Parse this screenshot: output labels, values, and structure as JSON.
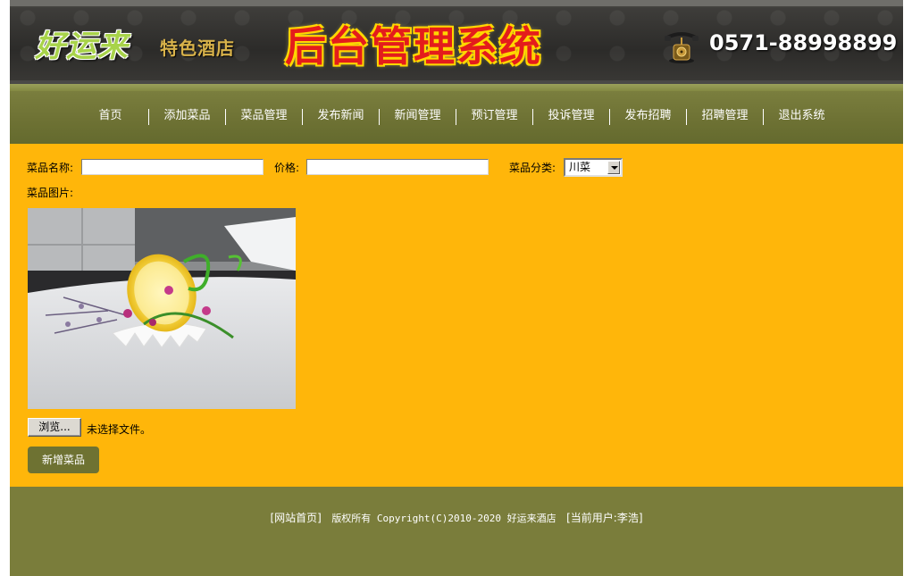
{
  "banner": {
    "logo_main": "好运来",
    "logo_sub": "特色酒店",
    "title": "后台管理系统",
    "phone": "0571-88998899"
  },
  "nav": {
    "items": [
      {
        "label": "首页"
      },
      {
        "label": "添加菜品"
      },
      {
        "label": "菜品管理"
      },
      {
        "label": "发布新闻"
      },
      {
        "label": "新闻管理"
      },
      {
        "label": "预订管理"
      },
      {
        "label": "投诉管理"
      },
      {
        "label": "发布招聘"
      },
      {
        "label": "招聘管理"
      },
      {
        "label": "退出系统"
      }
    ]
  },
  "form": {
    "name_label": "菜品名称:",
    "name_value": "",
    "price_label": "价格:",
    "price_value": "",
    "category_label": "菜品分类:",
    "category_value": "川菜",
    "image_label": "菜品图片:",
    "browse_label": "浏览...",
    "file_status": "未选择文件。",
    "submit_label": "新增菜品"
  },
  "footer": {
    "home_link": "[网站首页]",
    "copyright": "版权所有 Copyright(C)2010-2020 好运来酒店",
    "current_user": "[当前用户:李浩]"
  },
  "colors": {
    "banner": "#2f2e2b",
    "nav": "#6e7234",
    "content": "#ffb60a",
    "footer": "#7a7d3b",
    "title_red": "#e41c1c"
  }
}
